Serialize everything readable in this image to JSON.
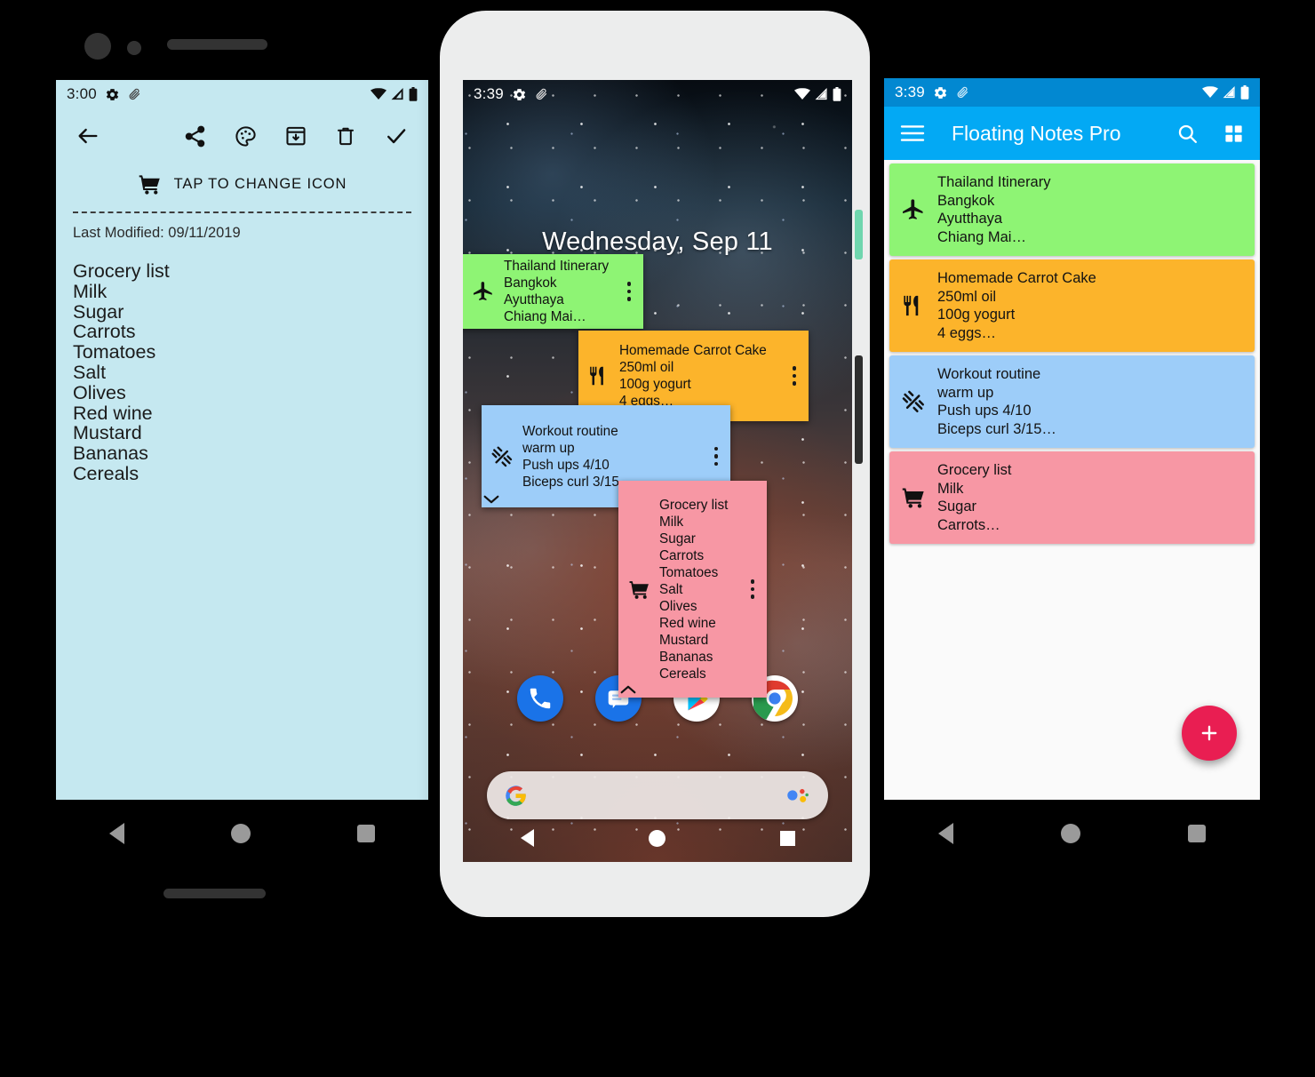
{
  "left_phone": {
    "status_bar": {
      "time": "3:00",
      "icons": [
        "gear-icon",
        "paperclip-icon",
        "wifi-icon",
        "signal-icon",
        "battery-icon"
      ]
    },
    "toolbar": {
      "back": "back-arrow-icon",
      "actions": [
        "share-icon",
        "palette-icon",
        "archive-icon",
        "delete-icon",
        "check-icon"
      ]
    },
    "change_icon_row": {
      "icon": "shopping-cart-icon",
      "label": "TAP TO CHANGE ICON"
    },
    "last_modified": "Last Modified: 09/11/2019",
    "note_lines": [
      "Grocery list",
      "Milk",
      "Sugar",
      "Carrots",
      "Tomatoes",
      "Salt",
      "Olives",
      "Red wine",
      "Mustard",
      "Bananas",
      "Cereals"
    ],
    "background_color": "#c5e8f0",
    "nav": [
      "back-triangle-icon",
      "home-circle-icon",
      "recents-square-icon"
    ]
  },
  "center_phone": {
    "status_bar": {
      "time": "3:39",
      "icons": [
        "gear-icon",
        "paperclip-icon",
        "wifi-icon",
        "signal-icon",
        "battery-icon"
      ]
    },
    "home_date": "Wednesday, Sep 11",
    "floating_notes": [
      {
        "id": "thailand",
        "color": "#8ef474",
        "icon": "airplane-icon",
        "lines": [
          "Thailand Itinerary",
          "Bangkok",
          "Ayutthaya",
          "Chiang Mai…"
        ],
        "menu": "more-vert-icon",
        "chevron": null
      },
      {
        "id": "carrotcake",
        "color": "#fcb42b",
        "icon": "restaurant-icon",
        "lines": [
          "Homemade Carrot Cake",
          "250ml oil",
          "100g yogurt",
          "4 eggs…"
        ],
        "menu": "more-vert-icon",
        "chevron": null
      },
      {
        "id": "workout",
        "color": "#9dcdf9",
        "icon": "dumbbell-icon",
        "lines": [
          "Workout routine",
          "warm up",
          "Push ups 4/10",
          "Biceps curl 3/15…"
        ],
        "menu": "more-vert-icon",
        "chevron": "chevron-down-icon"
      },
      {
        "id": "grocery",
        "color": "#f797a4",
        "icon": "shopping-cart-icon",
        "lines": [
          "Grocery list",
          "Milk",
          "Sugar",
          "Carrots",
          "Tomatoes",
          "Salt",
          "Olives",
          "Red wine",
          "Mustard",
          "Bananas",
          "Cereals"
        ],
        "menu": "more-vert-icon",
        "chevron": "chevron-up-icon"
      }
    ],
    "dock": [
      "phone-icon",
      "messages-icon",
      "play-store-icon",
      "chrome-icon"
    ],
    "search_bar": {
      "left_icon": "google-g-icon",
      "right_icon": "google-assistant-icon",
      "placeholder": ""
    },
    "nav": [
      "back-triangle-icon",
      "home-circle-icon",
      "recents-square-icon"
    ]
  },
  "right_phone": {
    "status_bar": {
      "time": "3:39",
      "icons": [
        "gear-icon",
        "paperclip-icon",
        "wifi-icon",
        "signal-icon",
        "battery-icon"
      ],
      "color": "#0288d1"
    },
    "app_bar": {
      "menu": "hamburger-menu-icon",
      "title": "Floating Notes Pro",
      "search": "search-icon",
      "grid": "grid-view-icon",
      "color": "#03a9f4"
    },
    "note_cards": [
      {
        "color": "#8ef474",
        "icon": "airplane-icon",
        "lines": [
          "Thailand Itinerary",
          "Bangkok",
          "Ayutthaya",
          "Chiang Mai…"
        ]
      },
      {
        "color": "#fcb42b",
        "icon": "restaurant-icon",
        "lines": [
          "Homemade Carrot Cake",
          "250ml oil",
          "100g yogurt",
          "4 eggs…"
        ]
      },
      {
        "color": "#9dcdf9",
        "icon": "dumbbell-icon",
        "lines": [
          "Workout routine",
          "warm up",
          "Push ups 4/10",
          "Biceps curl 3/15…"
        ]
      },
      {
        "color": "#f797a4",
        "icon": "shopping-cart-icon",
        "lines": [
          "Grocery list",
          "Milk",
          "Sugar",
          "Carrots…"
        ]
      }
    ],
    "fab": {
      "icon": "plus-icon",
      "color": "#e91e52",
      "label": "+"
    },
    "nav": [
      "back-triangle-icon",
      "home-circle-icon",
      "recents-square-icon"
    ]
  }
}
